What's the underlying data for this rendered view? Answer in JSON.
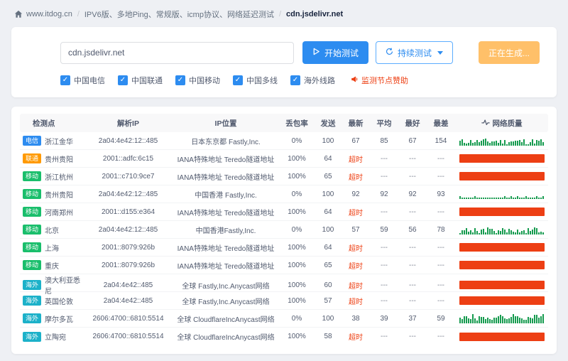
{
  "breadcrumb": {
    "site": "www.itdog.cn",
    "sep": "/",
    "section": "IPV6版、多地Ping、常规版、icmp协议、网络延迟测试",
    "target": "cdn.jsdelivr.net"
  },
  "test_panel": {
    "input_value": "cdn.jsdelivr.net",
    "buttons": {
      "start": "开始测试",
      "continuous": "持续测试",
      "generating": "正在生成..."
    },
    "checkboxes": [
      {
        "label": "中国电信",
        "checked": true
      },
      {
        "label": "中国联通",
        "checked": true
      },
      {
        "label": "中国移动",
        "checked": true
      },
      {
        "label": "中国多线",
        "checked": true
      },
      {
        "label": "海外线路",
        "checked": true
      }
    ],
    "sponsor": "监测节点赞助"
  },
  "icons": {
    "home": "home-icon",
    "play": "play-icon",
    "refresh": "refresh-icon",
    "caret_down": "chevron-down-icon",
    "check": "✓",
    "sponsor": "megaphone-icon",
    "quality": "pulse-icon"
  },
  "table": {
    "headers": [
      "检测点",
      "解析IP",
      "IP位置",
      "丢包率",
      "发送",
      "最新",
      "平均",
      "最好",
      "最差",
      "网络质量"
    ],
    "rows": [
      {
        "carrier": "电信",
        "carrier_type": "telecom",
        "location": "浙江金华",
        "ip": "2a04:4e42:12::485",
        "ip_location": "日本东京都 Fastly,Inc.",
        "loss": "0%",
        "sent": "100",
        "latest": "67",
        "avg": "85",
        "best": "67",
        "worst": "154",
        "quality": "ok",
        "spark_profile": "jagged"
      },
      {
        "carrier": "联通",
        "carrier_type": "unicom",
        "location": "贵州贵阳",
        "ip": "2001::adfc:6c15",
        "ip_location": "IANA特殊地址 Teredo隧道地址",
        "loss": "100%",
        "sent": "64",
        "latest": "超时",
        "avg": "---",
        "best": "---",
        "worst": "---",
        "quality": "timeout",
        "spark_profile": ""
      },
      {
        "carrier": "移动",
        "carrier_type": "mobile",
        "location": "浙江杭州",
        "ip": "2001::c710:9ce7",
        "ip_location": "IANA特殊地址 Teredo隧道地址",
        "loss": "100%",
        "sent": "65",
        "latest": "超时",
        "avg": "---",
        "best": "---",
        "worst": "---",
        "quality": "timeout",
        "spark_profile": ""
      },
      {
        "carrier": "移动",
        "carrier_type": "mobile",
        "location": "贵州贵阳",
        "ip": "2a04:4e42:12::485",
        "ip_location": "中国香港 Fastly,Inc.",
        "loss": "0%",
        "sent": "100",
        "latest": "92",
        "avg": "92",
        "best": "92",
        "worst": "93",
        "quality": "ok",
        "spark_profile": "flat"
      },
      {
        "carrier": "移动",
        "carrier_type": "mobile",
        "location": "河南郑州",
        "ip": "2001::d155:e364",
        "ip_location": "IANA特殊地址 Teredo隧道地址",
        "loss": "100%",
        "sent": "64",
        "latest": "超时",
        "avg": "---",
        "best": "---",
        "worst": "---",
        "quality": "timeout",
        "spark_profile": ""
      },
      {
        "carrier": "移动",
        "carrier_type": "mobile",
        "location": "北京",
        "ip": "2a04:4e42:12::485",
        "ip_location": "中国香港Fastly,Inc.",
        "loss": "0%",
        "sent": "100",
        "latest": "57",
        "avg": "59",
        "best": "56",
        "worst": "78",
        "quality": "ok",
        "spark_profile": "jagged"
      },
      {
        "carrier": "移动",
        "carrier_type": "mobile",
        "location": "上海",
        "ip": "2001::8079:926b",
        "ip_location": "IANA特殊地址 Teredo隧道地址",
        "loss": "100%",
        "sent": "64",
        "latest": "超时",
        "avg": "---",
        "best": "---",
        "worst": "---",
        "quality": "timeout",
        "spark_profile": ""
      },
      {
        "carrier": "移动",
        "carrier_type": "mobile",
        "location": "重庆",
        "ip": "2001::8079:926b",
        "ip_location": "IANA特殊地址 Teredo隧道地址",
        "loss": "100%",
        "sent": "65",
        "latest": "超时",
        "avg": "---",
        "best": "---",
        "worst": "---",
        "quality": "timeout",
        "spark_profile": ""
      },
      {
        "carrier": "海外",
        "carrier_type": "overseas",
        "location": "澳大利亚悉尼",
        "ip": "2a04:4e42::485",
        "ip_location": "全球 Fastly,Inc.Anycast网络",
        "loss": "100%",
        "sent": "60",
        "latest": "超时",
        "avg": "---",
        "best": "---",
        "worst": "---",
        "quality": "timeout",
        "spark_profile": ""
      },
      {
        "carrier": "海外",
        "carrier_type": "overseas",
        "location": "英国伦敦",
        "ip": "2a04:4e42::485",
        "ip_location": "全球 Fastly,Inc.Anycast网络",
        "loss": "100%",
        "sent": "57",
        "latest": "超时",
        "avg": "---",
        "best": "---",
        "worst": "---",
        "quality": "timeout",
        "spark_profile": ""
      },
      {
        "carrier": "海外",
        "carrier_type": "overseas",
        "location": "摩尔多瓦",
        "ip": "2606:4700::6810:5514",
        "ip_location": "全球 CloudflareIncAnycast网络",
        "loss": "0%",
        "sent": "100",
        "latest": "38",
        "avg": "39",
        "best": "37",
        "worst": "59",
        "quality": "ok",
        "spark_profile": "tall"
      },
      {
        "carrier": "海外",
        "carrier_type": "overseas",
        "location": "立陶宛",
        "ip": "2606:4700::6810:5514",
        "ip_location": "全球 CloudflareIncAnycast网络",
        "loss": "100%",
        "sent": "58",
        "latest": "超时",
        "avg": "---",
        "best": "---",
        "worst": "---",
        "quality": "timeout",
        "spark_profile": ""
      }
    ]
  },
  "theme": {
    "accent": "#2d8cf0",
    "error": "#ed4014",
    "spark_green": "#169b4f",
    "spark_red": "#ed3f14",
    "carrier_colors": {
      "telecom": "#2d8cf0",
      "unicom": "#ff9900",
      "mobile": "#19be6b",
      "overseas": "#1cb1c9"
    }
  }
}
